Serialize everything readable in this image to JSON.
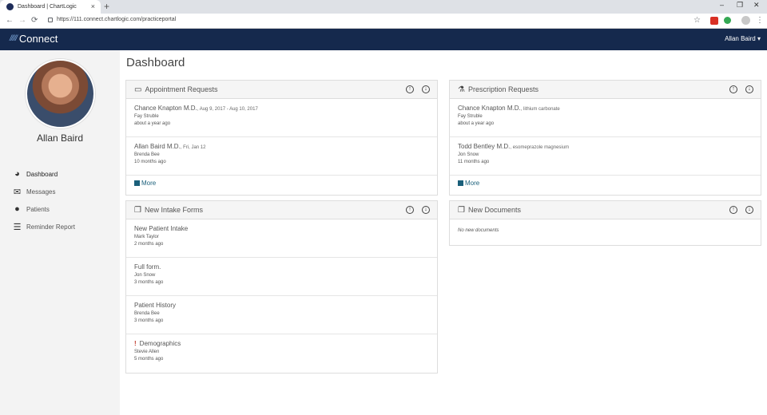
{
  "browser": {
    "tab_title": "Dashboard | ChartLogic",
    "tab_close": "×",
    "new_tab": "+",
    "url": "https://111.connect.chartlogic.com/practiceportal",
    "back": "←",
    "forward": "→",
    "reload": "⟳",
    "star": "☆",
    "menu": "⋮",
    "minimize": "–",
    "maximize": "❐",
    "close": "✕"
  },
  "header": {
    "logo_text": "Connect",
    "user_menu": "Allan Baird ▾"
  },
  "sidebar": {
    "user_name": "Allan Baird",
    "items": [
      {
        "label": "Dashboard",
        "icon": "tachometer-icon",
        "glyph": "◕"
      },
      {
        "label": "Messages",
        "icon": "envelope-icon",
        "glyph": "✉"
      },
      {
        "label": "Patients",
        "icon": "user-icon",
        "glyph": "●"
      },
      {
        "label": "Reminder Report",
        "icon": "list-icon",
        "glyph": "☰"
      }
    ]
  },
  "main": {
    "title": "Dashboard",
    "appointment_requests": {
      "title": "Appointment Requests",
      "rows": [
        {
          "name": "Chance Knapton M.D.",
          "detail": ", Aug 9, 2017 - Aug 10, 2017",
          "sub": "Fay Struble",
          "time": "about a year ago"
        },
        {
          "name": "Allan Baird M.D.",
          "detail": ", Fri, Jan 12",
          "sub": "Brenda Bee",
          "time": "10 months ago"
        }
      ],
      "more": "More"
    },
    "prescription_requests": {
      "title": "Prescription Requests",
      "rows": [
        {
          "name": "Chance Knapton M.D.",
          "detail": ", lithium carbonate",
          "sub": "Fay Struble",
          "time": "about a year ago"
        },
        {
          "name": "Todd Bentley M.D.",
          "detail": ", esomeprazole magnesium",
          "sub": "Jon Snow",
          "time": "11 months ago"
        }
      ],
      "more": "More"
    },
    "new_intake_forms": {
      "title": "New Intake Forms",
      "rows": [
        {
          "name": "New Patient Intake",
          "sub": "Mark Taylor",
          "time": "2 months ago"
        },
        {
          "name": "Full form.",
          "sub": "Jon Snow",
          "time": "3 months ago"
        },
        {
          "name": "Patient History",
          "sub": "Brenda Bee",
          "time": "3 months ago"
        },
        {
          "flag": "!",
          "name": "Demographics",
          "sub": "Stevie Allen",
          "time": "5 months ago"
        }
      ]
    },
    "new_documents": {
      "title": "New Documents",
      "empty": "No new documents"
    }
  }
}
